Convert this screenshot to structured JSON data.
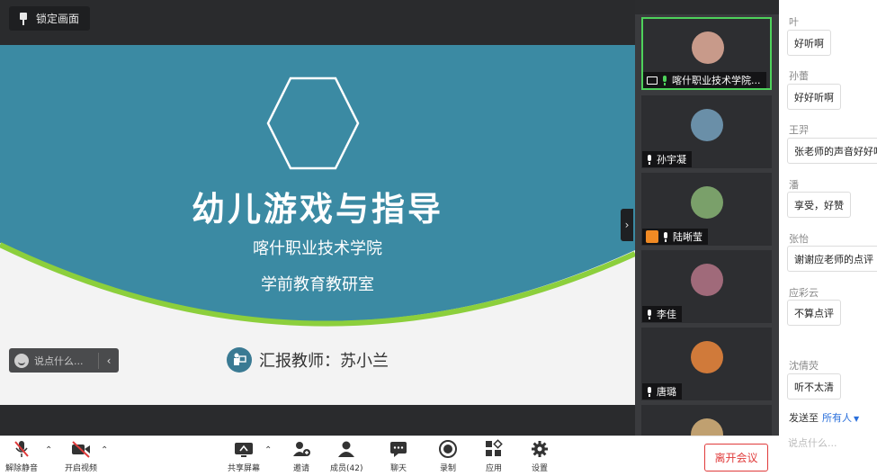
{
  "stage": {
    "lock_label": "锁定画面",
    "slide": {
      "title": "幼儿游戏与指导",
      "school": "喀什职业技术学院",
      "dept": "学前教育教研室",
      "reporter": "汇报教师：苏小兰"
    },
    "say_placeholder": "说点什么...",
    "collapse_icon": "chevron-right"
  },
  "participants": [
    {
      "name": "喀什职业技术学院...",
      "active": true,
      "mic": "on",
      "sharing": true,
      "avatar_color": "#c89a8a"
    },
    {
      "name": "孙宇凝",
      "active": false,
      "mic": "muted",
      "avatar_color": "#6a8fa8"
    },
    {
      "name": "陆晰莹",
      "active": false,
      "mic": "on-white",
      "host": true,
      "avatar_color": "#7aa06a"
    },
    {
      "name": "李佳",
      "active": false,
      "mic": "muted",
      "avatar_color": "#a06a7a"
    },
    {
      "name": "唐璐",
      "active": false,
      "mic": "muted",
      "avatar_color": "#d07a3a"
    }
  ],
  "chat": {
    "messages": [
      {
        "name": "叶",
        "text": "好听啊"
      },
      {
        "name": "孙蕾",
        "text": "好好听啊"
      },
      {
        "name": "王羿",
        "text": "张老师的声音好好听"
      },
      {
        "name": "潘",
        "text": "享受，好赞"
      },
      {
        "name": "张怡",
        "text": "谢谢应老师的点评"
      },
      {
        "name": "应彩云",
        "text": "不算点评"
      },
      {
        "name": "沈倩荧",
        "text": "听不太清"
      }
    ],
    "send_to_label": "发送至",
    "send_to_target": "所有人",
    "input_placeholder": "说点什么..."
  },
  "toolbar": {
    "unmute": "解除静音",
    "start_video": "开启视频",
    "share_screen": "共享屏幕",
    "invite": "邀请",
    "members": "成员(42)",
    "chat": "聊天",
    "record": "录制",
    "apps": "应用",
    "settings": "设置",
    "leave": "离开会议"
  },
  "colors": {
    "slide_teal": "#3b8aa3",
    "slide_green": "#8ccf3c",
    "active_border": "#4ed25b",
    "leave_red": "#e03b3b",
    "link_blue": "#2a6fdb"
  }
}
